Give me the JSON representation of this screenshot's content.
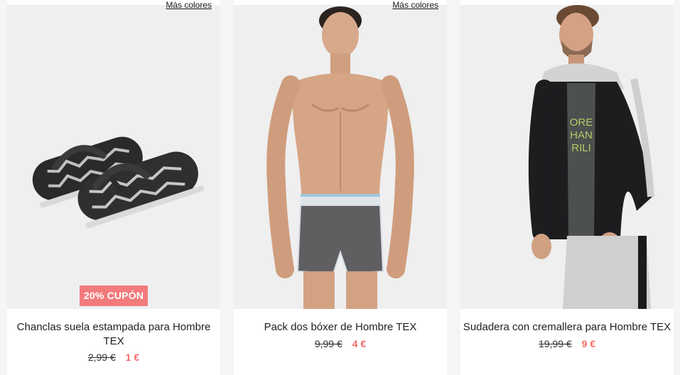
{
  "products": [
    {
      "more_colors": "Más colores",
      "coupon": "20% CUPÓN",
      "title": "Chanclas suela estampada para Hombre TEX",
      "old_price": "2,99 €",
      "new_price": "1 €",
      "image_icon": "flip-flops-image"
    },
    {
      "more_colors": "Más colores",
      "title": "Pack dos bóxer de Hombre TEX",
      "old_price": "9,99 €",
      "new_price": "4 €",
      "image_icon": "boxer-model-image"
    },
    {
      "title": "Sudadera con cremallera para Hombre TEX",
      "old_price": "19,99 €",
      "new_price": "9 €",
      "image_icon": "hoodie-model-image"
    }
  ],
  "colors": {
    "accent": "#f26b6b",
    "coupon_bg": "#f27b7b",
    "card_bg": "#ffffff",
    "image_bg": "#efefef"
  }
}
